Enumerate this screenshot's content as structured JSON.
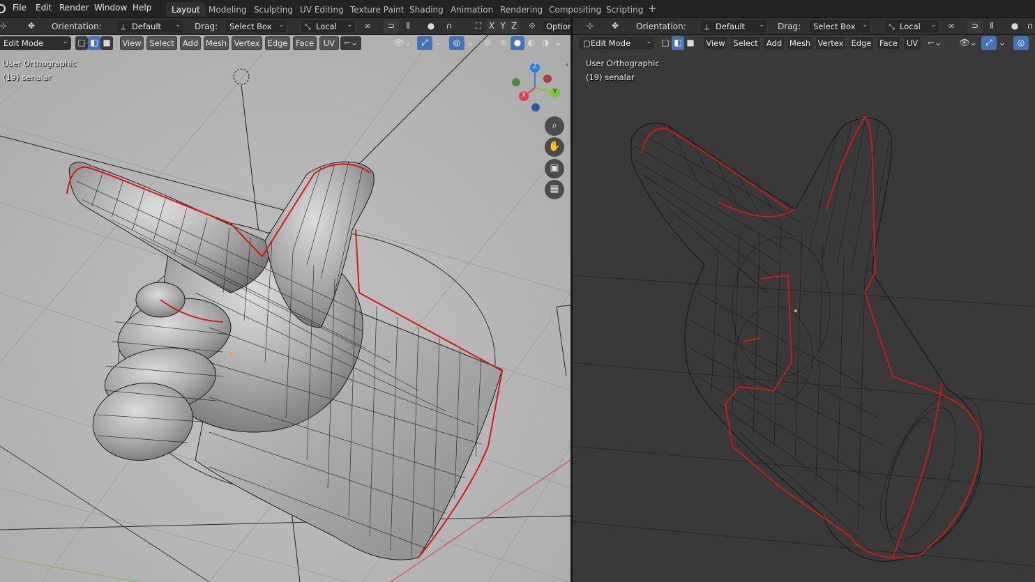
{
  "menu": [
    "File",
    "Edit",
    "Render",
    "Window",
    "Help"
  ],
  "workspaces": [
    {
      "label": "Layout",
      "active": true
    },
    {
      "label": "Modeling",
      "active": false
    },
    {
      "label": "Sculpting",
      "active": false
    },
    {
      "label": "UV Editing",
      "active": false
    },
    {
      "label": "Texture Paint",
      "active": false
    },
    {
      "label": "Shading",
      "active": false
    },
    {
      "label": "Animation",
      "active": false
    },
    {
      "label": "Rendering",
      "active": false
    },
    {
      "label": "Compositing",
      "active": false
    },
    {
      "label": "Scripting",
      "active": false
    }
  ],
  "add_workspace": "+",
  "tool_header": {
    "orientation_label": "Orientation:",
    "orientation_value": "Default",
    "drag_label": "Drag:",
    "drag_value": "Select Box",
    "pivot_value": "Local",
    "axes": [
      "X",
      "Y",
      "Z"
    ],
    "options_label": "Options"
  },
  "view_header": {
    "mode": "Edit Mode",
    "menus": [
      "View",
      "Select",
      "Add",
      "Mesh",
      "Vertex",
      "Edge",
      "Face",
      "UV"
    ]
  },
  "viewport": {
    "view_name": "User Orthographic",
    "object_info": "(19) senalar"
  },
  "gizmo": {
    "z": "Z",
    "y": "Y",
    "x": "X"
  },
  "colors": {
    "accent": "#4772b3",
    "seam": "#d41a10",
    "solid_bg": "#b6b6b6",
    "wire_bg": "#393939",
    "axis_x": "#e8394a",
    "axis_y": "#7ec636",
    "axis_z": "#2d80e8"
  },
  "icons": {
    "zoom": "zoom-icon",
    "pan": "hand-icon",
    "camera": "camera-icon",
    "grid": "grid-icon"
  }
}
